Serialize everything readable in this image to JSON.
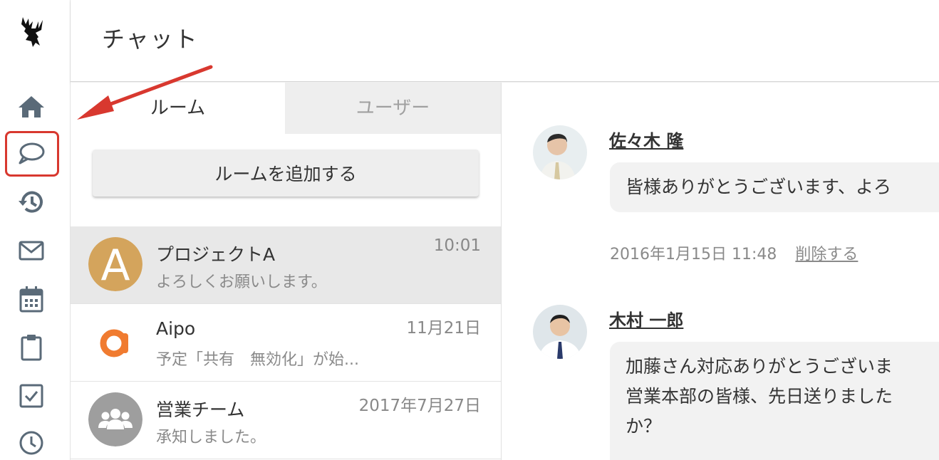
{
  "header": {
    "title": "チャット"
  },
  "sidebar": {
    "items": [
      {
        "name": "home",
        "icon": "home-icon"
      },
      {
        "name": "chat",
        "icon": "chat-bubble-icon",
        "active": true
      },
      {
        "name": "history",
        "icon": "history-icon"
      },
      {
        "name": "mail",
        "icon": "mail-icon"
      },
      {
        "name": "calendar",
        "icon": "calendar-icon"
      },
      {
        "name": "clipboard",
        "icon": "clipboard-icon"
      },
      {
        "name": "todo",
        "icon": "checkbox-icon"
      },
      {
        "name": "timecard",
        "icon": "clock-icon"
      }
    ]
  },
  "rooms": {
    "tabs": [
      "ルーム",
      "ユーザー"
    ],
    "add_button": "ルームを追加する",
    "list": [
      {
        "initial": "A",
        "name": "プロジェクトA",
        "last_message": "よろしくお願いします。",
        "time": "10:01",
        "selected": true
      },
      {
        "initial": "a",
        "name": "Aipo",
        "last_message": "予定「共有　無効化」が始...",
        "time": "11月21日"
      },
      {
        "initial": "",
        "name": "営業チーム",
        "last_message": "承知しました。",
        "time": "2017年7月27日"
      }
    ]
  },
  "chat": {
    "messages": [
      {
        "sender": "佐々木 隆",
        "lines": [
          "皆様ありがとうございます、よろ"
        ],
        "timestamp": "2016年1月15日 11:48",
        "delete_label": "削除する"
      },
      {
        "sender": "木村 一郎",
        "lines": [
          "加藤さん対応ありがとうございま",
          "営業本部の皆様、先日送りました",
          "か？"
        ]
      }
    ]
  },
  "colors": {
    "accent": "#d8382f",
    "room_a_avatar": "#d4a45c",
    "aipo_orange": "#f07b30",
    "icon_gray": "#5a6a78"
  }
}
